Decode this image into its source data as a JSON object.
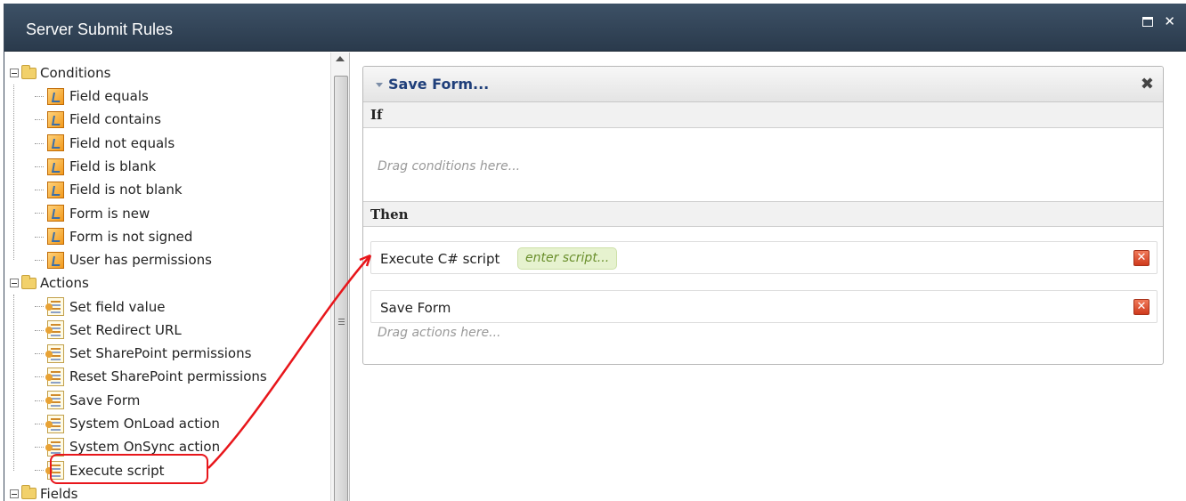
{
  "window": {
    "title": "Server Submit Rules",
    "controls": {
      "maximize_icon": "maximize-icon",
      "close_glyph": "✕"
    }
  },
  "tree": {
    "groups": [
      {
        "label": "Conditions",
        "icon": "folder-icon",
        "items": [
          "Field equals",
          "Field contains",
          "Field not equals",
          "Field is blank",
          "Field is not blank",
          "Form is new",
          "Form is not signed",
          "User has permissions"
        ]
      },
      {
        "label": "Actions",
        "icon": "folder-icon",
        "items": [
          "Set field value",
          "Set Redirect URL",
          "Set SharePoint permissions",
          "Reset SharePoint permissions",
          "Save Form",
          "System OnLoad action",
          "System OnSync action",
          "Execute script"
        ]
      },
      {
        "label": "Fields",
        "icon": "folder-icon",
        "items": []
      }
    ]
  },
  "rule": {
    "title": "Save Form...",
    "close_glyph": "✖",
    "if_label": "If",
    "if_placeholder": "Drag conditions here...",
    "then_label": "Then",
    "actions": [
      {
        "label": "Execute C# script",
        "chip": "enter script..."
      },
      {
        "label": "Save Form"
      }
    ],
    "then_placeholder": "Drag actions here...",
    "delete_glyph": "✕"
  },
  "colors": {
    "titlebar": "#2f4255",
    "rule_title": "#1f3f7a",
    "annotation": "#e8161b",
    "chip_bg": "#e6f2cf"
  }
}
